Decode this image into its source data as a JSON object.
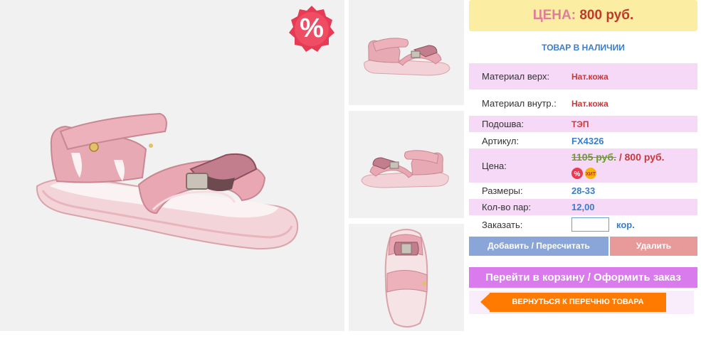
{
  "sale_badge": {
    "symbol": "%",
    "color": "#e73a55"
  },
  "price_header": {
    "label": "ЦЕНА:",
    "value": "800 руб."
  },
  "stock_status": "ТОВАР В НАЛИЧИИ",
  "specs": [
    {
      "label": "Материал верх:",
      "value": "Нат.кожа"
    },
    {
      "label": "Материал внутр.:",
      "value": "Нат.кожа"
    },
    {
      "label": "Подошва:",
      "value": "ТЭП"
    },
    {
      "label": "Артикул:",
      "value": "FX4326"
    }
  ],
  "price_row": {
    "label": "Цена:",
    "old": "1105 руб.",
    "separator": " / ",
    "new": "800 руб.",
    "badges": [
      "%",
      "ХИТ"
    ]
  },
  "sizes": {
    "label": "Размеры:",
    "value": "28-33"
  },
  "pairs": {
    "label": "Кол-во пар:",
    "value": "12,00"
  },
  "order": {
    "label": "Заказать:",
    "input_value": "",
    "unit": "кор."
  },
  "buttons": {
    "add": "Добавить / Пересчитать",
    "delete": "Удалить",
    "cart": "Перейти в корзину / Оформить заказ",
    "back": "ВЕРНУТЬСЯ К ПЕРЕЧНЮ ТОВАРА"
  },
  "colors": {
    "accent_pink": "#d97bec",
    "row_pink": "#f5d9f7",
    "price_yellow": "#fbeea3",
    "link_blue": "#3b7dc9",
    "orange": "#ff7a00"
  }
}
